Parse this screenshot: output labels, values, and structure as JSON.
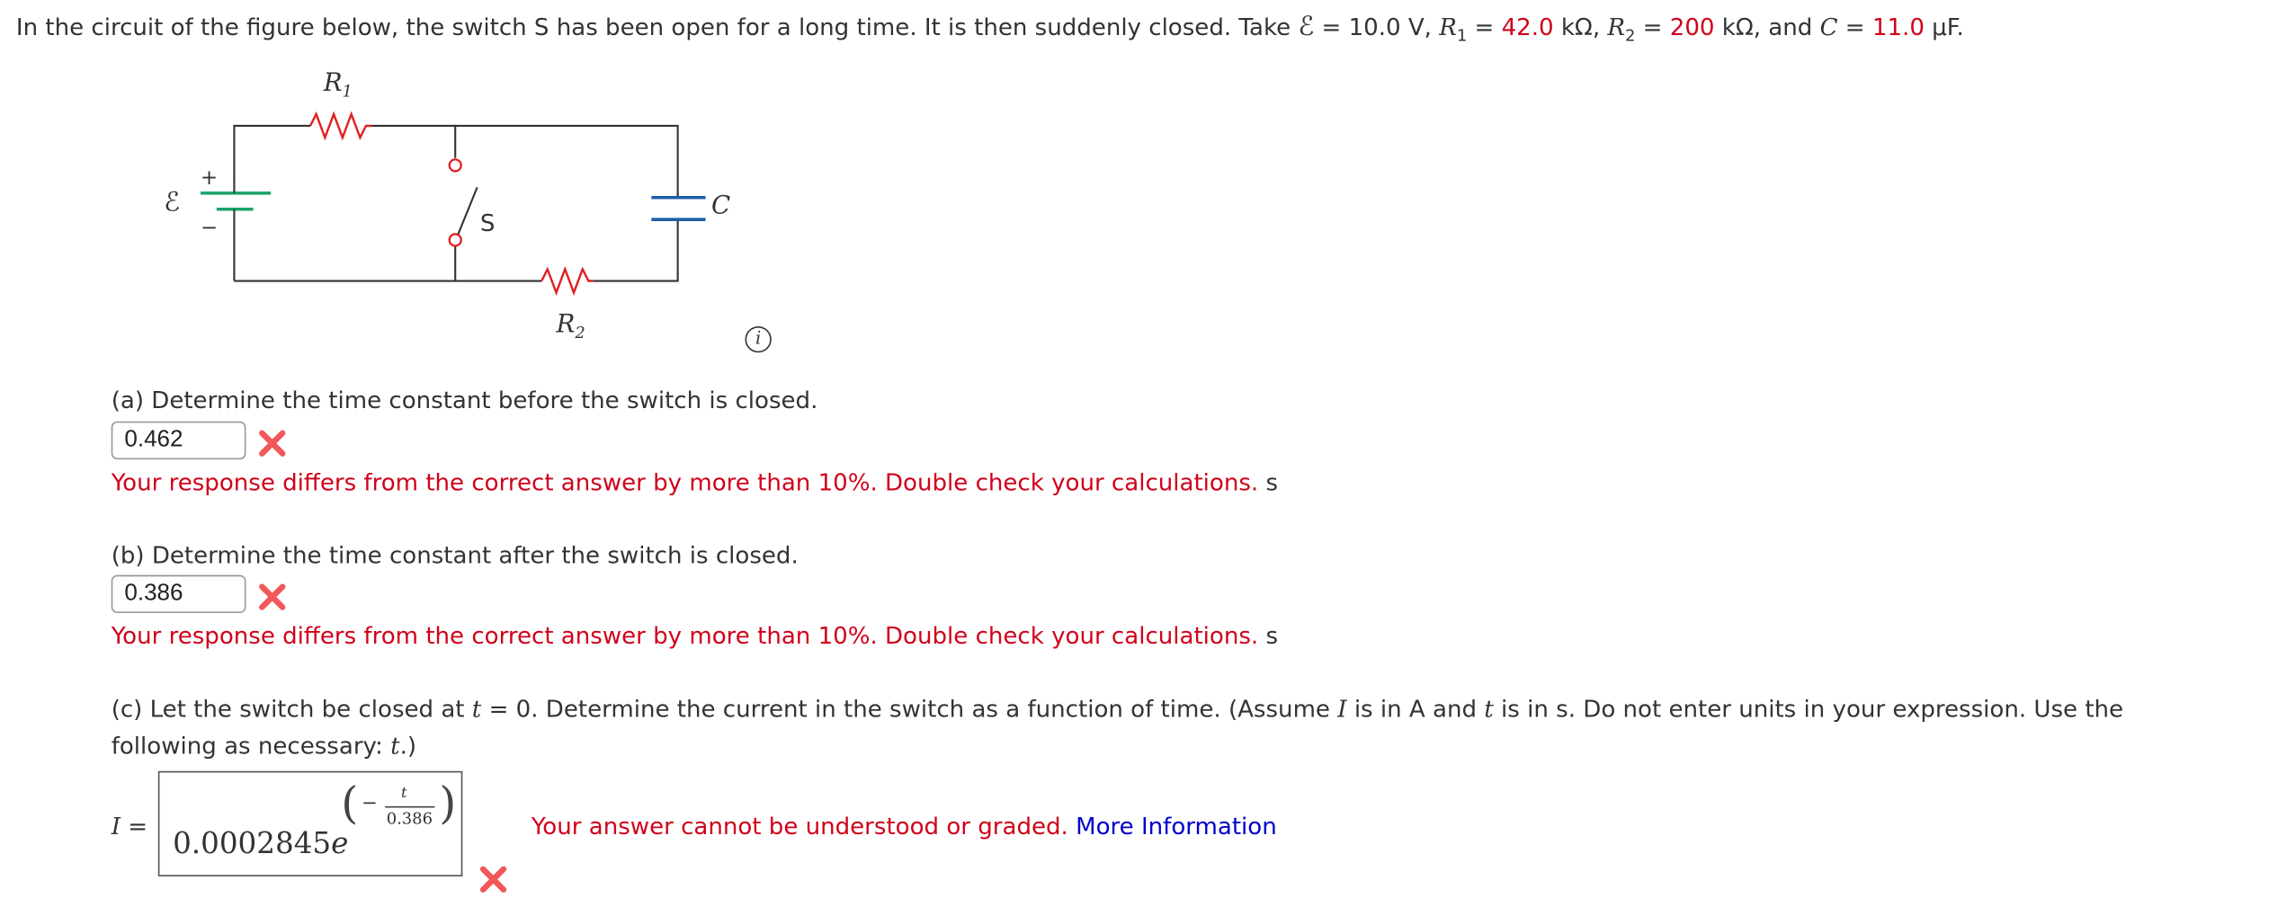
{
  "problem": {
    "intro_pre": "In the circuit of the figure below, the switch S has been open for a long time. It is then suddenly closed. Take ",
    "emf_symbol": "ℰ",
    "emf_eq": " = 10.0 V, ",
    "r1_sym": "R",
    "r1_sub": "1",
    "r1_eq": " = ",
    "r1_val": "42.0",
    "r1_unit": " kΩ, ",
    "r2_sym": "R",
    "r2_sub": "2",
    "r2_eq": " = ",
    "r2_val": "200",
    "r2_unit": " kΩ, and ",
    "c_sym": "C",
    "c_eq": " = ",
    "c_val": "11.0",
    "c_unit": " μF."
  },
  "figure": {
    "r1_label": "R",
    "r1_sub": "1",
    "r2_label": "R",
    "r2_sub": "2",
    "c_label": "C",
    "s_label": "S",
    "emf_label": "ℰ",
    "plus": "+",
    "minus": "−",
    "info_icon": "i"
  },
  "part_a": {
    "question": "(a) Determine the time constant before the switch is closed.",
    "answer": "0.462",
    "feedback": "Your response differs from the correct answer by more than 10%. Double check your calculations.",
    "unit": "s"
  },
  "part_b": {
    "question": "(b) Determine the time constant after the switch is closed.",
    "answer": "0.386",
    "feedback": "Your response differs from the correct answer by more than 10%. Double check your calculations.",
    "unit": "s"
  },
  "part_c": {
    "q1": "(c) Let the switch be closed at ",
    "t1": "t",
    "q2": " = 0. Determine the current in the switch as a function of time. (Assume ",
    "i1": "I",
    "q3": " is in A and ",
    "t2": "t",
    "q4": " is in s. Do not enter units in your expression. Use the",
    "q5": "following as necessary: ",
    "t3": "t",
    "q6": ".)",
    "lhs": "I",
    "eq": "=",
    "coef": "0.0002845",
    "base": "e",
    "exp_open": "(",
    "exp_minus": "−",
    "exp_num": "t",
    "exp_den": "0.386",
    "exp_close": ")",
    "feedback": "Your answer cannot be understood or graded.",
    "more_info": "More Information"
  },
  "colors": {
    "error_red": "#d0021b",
    "link_blue": "#0000cc",
    "battery_green": "#1aa36b",
    "capacitor_blue": "#1f5fa8",
    "resistor_red": "#e02020"
  }
}
